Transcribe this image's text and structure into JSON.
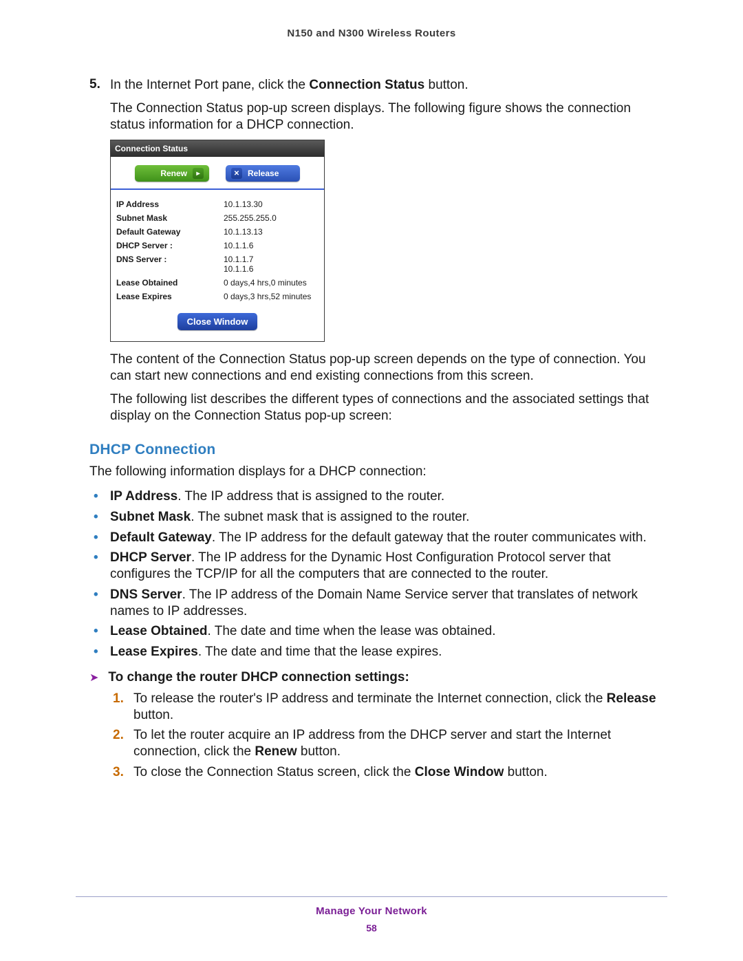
{
  "header": {
    "title": "N150 and N300 Wireless Routers"
  },
  "step5": {
    "num": "5.",
    "text_pre": "In the Internet Port pane, click the ",
    "text_bold": "Connection Status",
    "text_post": " button."
  },
  "after_step_para": "The Connection Status pop-up screen displays. The following figure shows the connection status information for a DHCP connection.",
  "figure": {
    "title": "Connection Status",
    "renew": "Renew",
    "release": "Release",
    "rows": {
      "ip_label": "IP Address",
      "ip_val": "10.1.13.30",
      "sm_label": "Subnet Mask",
      "sm_val": "255.255.255.0",
      "gw_label": "Default Gateway",
      "gw_val": "10.1.13.13",
      "dhcp_label": "DHCP Server :",
      "dhcp_val": "10.1.1.6",
      "dns_label": "DNS Server :",
      "dns_val1": "10.1.1.7",
      "dns_val2": "10.1.1.6",
      "lo_label": "Lease Obtained",
      "lo_val": "0 days,4 hrs,0 minutes",
      "le_label": "Lease Expires",
      "le_val": "0 days,3 hrs,52 minutes"
    },
    "close": "Close Window"
  },
  "para_after_fig": "The content of the Connection Status pop-up screen depends on the type of connection. You can start new connections and end existing connections from this screen.",
  "para_types": "The following list describes the different types of connections and the associated settings that display on the Connection Status pop-up screen:",
  "section_heading": "DHCP Connection",
  "section_intro": "The following information displays for a DHCP connection:",
  "bullets": [
    {
      "bold": "IP Address",
      "rest": ". The IP address that is assigned to the router."
    },
    {
      "bold": "Subnet Mask",
      "rest": ". The subnet mask that is assigned to the router."
    },
    {
      "bold": "Default Gateway",
      "rest": ". The IP address for the default gateway that the router communicates with."
    },
    {
      "bold": "DHCP Server",
      "rest": ". The IP address for the Dynamic Host Configuration Protocol server that configures the TCP/IP for all the computers that are connected to the router."
    },
    {
      "bold": "DNS Server",
      "rest": ". The IP address of the Domain Name Service server that translates of network names to IP addresses."
    },
    {
      "bold": "Lease Obtained",
      "rest": ". The date and time when the lease was obtained."
    },
    {
      "bold": "Lease Expires",
      "rest": ". The date and time that the lease expires."
    }
  ],
  "procedure": {
    "title": "To change the router DHCP connection settings:",
    "steps": [
      {
        "pre": "To release the router's IP address and terminate the Internet connection, click the ",
        "bold": "Release",
        "post": " button."
      },
      {
        "pre": "To let the router acquire an IP address from the DHCP server and start the Internet connection, click the ",
        "bold": "Renew",
        "post": " button."
      },
      {
        "pre": "To close the Connection Status screen, click the ",
        "bold": "Close Window",
        "post": " button."
      }
    ]
  },
  "footer": {
    "section": "Manage Your Network",
    "page": "58"
  }
}
